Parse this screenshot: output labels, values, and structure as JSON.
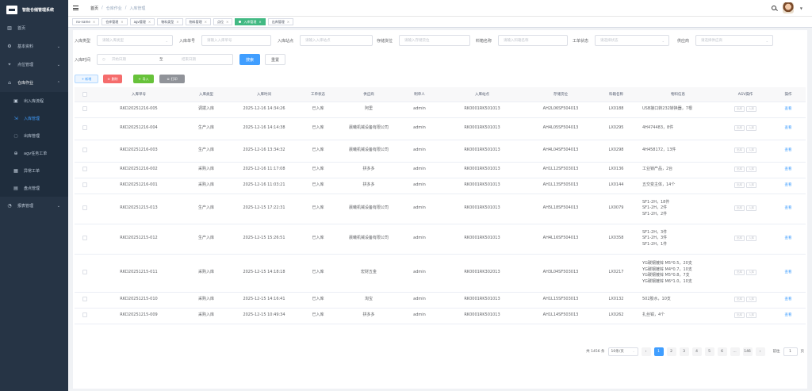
{
  "app": {
    "title": "智能仓储管理系统"
  },
  "sidebar": {
    "items": [
      {
        "label": "首页",
        "icon": "dashboard-icon"
      },
      {
        "label": "基本资料",
        "icon": "settings-icon",
        "arrow": "⌄"
      },
      {
        "label": "点位管理",
        "icon": "location-icon",
        "arrow": "⌄"
      },
      {
        "label": "仓库作业",
        "icon": "warehouse-icon",
        "arrow": "⌃"
      }
    ],
    "sub_items": [
      {
        "label": "出入库流程",
        "icon": "flow-icon"
      },
      {
        "label": "入库管理",
        "icon": "inbound-icon",
        "active": true
      },
      {
        "label": "出库管理",
        "icon": "outbound-icon"
      },
      {
        "label": "agv任务工单",
        "icon": "agv-icon"
      },
      {
        "label": "异常工单",
        "icon": "exception-icon"
      },
      {
        "label": "盘点管理",
        "icon": "inventory-icon"
      }
    ],
    "bottom_item": {
      "label": "报表管理",
      "icon": "report-icon",
      "arrow": "⌄"
    }
  },
  "navbar": {
    "breadcrumb": [
      "首页",
      "仓库作业",
      "入库管理"
    ],
    "separator": "/"
  },
  "tags": [
    {
      "label": "no-name",
      "active": false
    },
    {
      "label": "仓库管理",
      "active": false
    },
    {
      "label": "agv管理",
      "active": false
    },
    {
      "label": "物料类型",
      "active": false
    },
    {
      "label": "物料管理",
      "active": false
    },
    {
      "label": "点位",
      "active": false
    },
    {
      "label": "入库管理",
      "active": true
    },
    {
      "label": "出库管理",
      "active": false
    }
  ],
  "filters": {
    "type_label": "入库类型",
    "type_placeholder": "请输入库类型",
    "no_label": "入库单号",
    "no_placeholder": "请输入入库单号",
    "point_label": "入库站点",
    "point_placeholder": "请输入入库站点",
    "storage_label": "存储货位",
    "storage_placeholder": "请输入存储货位",
    "material_label": "料箱名称",
    "material_placeholder": "请输入料箱名称",
    "status_label": "工单状态",
    "status_placeholder": "请选择状态",
    "supplier_label": "供应商",
    "supplier_placeholder": "请选择供应商",
    "time_label": "入库时间",
    "start_placeholder": "开始日期",
    "range_sep": "至",
    "end_placeholder": "结束日期",
    "search_label": "搜索",
    "reset_label": "重置"
  },
  "toolbar": {
    "add": "+ 新增",
    "delete": "删除",
    "import": "导入",
    "print": "打印"
  },
  "table": {
    "columns": [
      "",
      "入库单号",
      "入库类型",
      "入库时间",
      "工单状态",
      "供应商",
      "制单人",
      "入库站点",
      "存储货位",
      "料箱名称",
      "物料信息",
      "AGV操作",
      "操作"
    ],
    "agv_buttons": [
      "出库",
      "入库"
    ],
    "view_label": "查看",
    "rows": [
      {
        "no": "RKD20251216-005",
        "type": "调拨入库",
        "time": "2025-12-16 14:34:26",
        "status": "已入库",
        "supplier": "阿里",
        "creator": "admin",
        "station": "RK0001RK501013",
        "location": "AH2L06SF504013",
        "box": "LX0188",
        "info": "USB接口转232转换器，7根"
      },
      {
        "no": "RKD20251216-004",
        "type": "生产入库",
        "time": "2025-12-16 14:14:38",
        "status": "已入库",
        "supplier": "晨曦机械设备有限公司",
        "creator": "admin",
        "station": "RK0001RK501013",
        "location": "AH4L05SF504013",
        "box": "LX0295",
        "info": "4H474483，8件"
      },
      {
        "no": "RKD20251216-003",
        "type": "生产入库",
        "time": "2025-12-16 13:34:32",
        "status": "已入库",
        "supplier": "晨曦机械设备有限公司",
        "creator": "admin",
        "station": "RK0001RK501013",
        "location": "AH4L04SF504013",
        "box": "LX0298",
        "info": "4H458172，13件"
      },
      {
        "no": "RKD20251216-002",
        "type": "采购入库",
        "time": "2025-12-16 11:17:08",
        "status": "已入库",
        "supplier": "拼多多",
        "creator": "admin",
        "station": "RK0001RK501013",
        "location": "AH1L12SF503013",
        "box": "LX0136",
        "info": "工业锁产品，2台"
      },
      {
        "no": "RKD20251216-001",
        "type": "采购入库",
        "time": "2025-12-16 11:03:21",
        "status": "已入库",
        "supplier": "拼多多",
        "creator": "admin",
        "station": "RK0001RK501013",
        "location": "AH1L13SF505013",
        "box": "LX0144",
        "info": "五交变主体，14个"
      },
      {
        "no": "RKD20251215-013",
        "type": "生产入库",
        "time": "2025-12-15 17:22:31",
        "status": "已入库",
        "supplier": "晨曦机械设备有限公司",
        "creator": "admin",
        "station": "RK0001RK501013",
        "location": "AH5L18SF504013",
        "box": "LX0079",
        "info": "SF1-2H，18件\nSF1-2H，2件\nSF1-2H，2件"
      },
      {
        "no": "RKD20251215-012",
        "type": "生产入库",
        "time": "2025-12-15 15:26:51",
        "status": "已入库",
        "supplier": "晨曦机械设备有限公司",
        "creator": "admin",
        "station": "RK0001RK501013",
        "location": "AH4L16SF504013",
        "box": "LX0358",
        "info": "SF1-2H，3件\nSF1-2H，3件\nSF1-2H，1件"
      },
      {
        "no": "RKD20251215-011",
        "type": "采购入库",
        "time": "2025-12-15 14:18:18",
        "status": "已入库",
        "supplier": "宏财五金",
        "creator": "admin",
        "station": "RK0001RK302013",
        "location": "AH3L04SF503013",
        "box": "LX0217",
        "info": "YG碳钢镀锌 M5*0.5，20支\nYG碳钢镀锌 M4*0.7，10支\nYG碳钢镀锌 M5*0.8，7支\nYG碳钢镀锌 M6*1.0，10支"
      },
      {
        "no": "RKD20251215-010",
        "type": "采购入库",
        "time": "2025-12-15 14:16:41",
        "status": "已入库",
        "supplier": "淘宝",
        "creator": "admin",
        "station": "RK0001RK501013",
        "location": "AH1L15SF503013",
        "box": "LX0132",
        "info": "502胶水，10支"
      },
      {
        "no": "RKD20251215-009",
        "type": "采购入库",
        "time": "2025-12-15 10:49:34",
        "status": "已入库",
        "supplier": "拼多多",
        "creator": "admin",
        "station": "RK0001RK501013",
        "location": "AH1L14SF503013",
        "box": "LX0262",
        "info": "扎丝钳，4个"
      }
    ]
  },
  "pagination": {
    "total": "共 1456 条",
    "page_size": "10条/页",
    "prev": "‹",
    "pages": [
      "1",
      "2",
      "3",
      "4",
      "5",
      "6",
      "...",
      "146"
    ],
    "next": "›",
    "goto_label": "前往",
    "goto_value": "1",
    "goto_suffix": "页"
  }
}
